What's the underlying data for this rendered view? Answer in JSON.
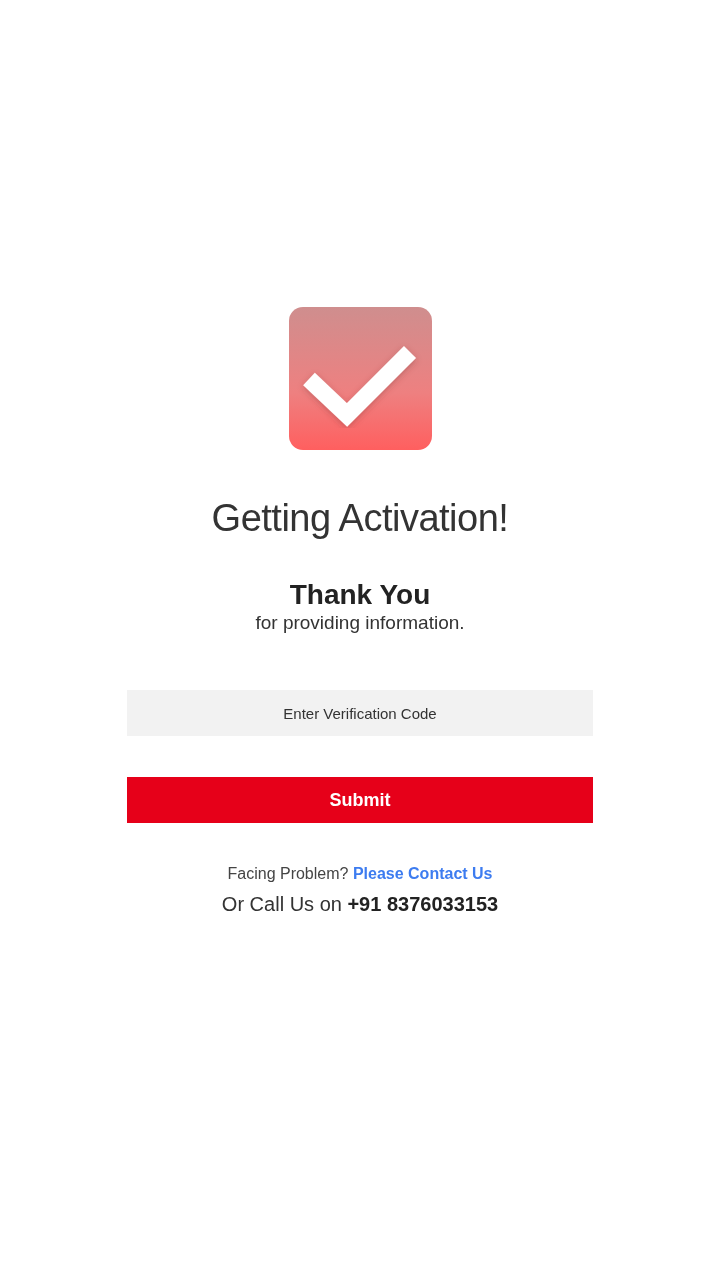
{
  "title": "Getting Activation!",
  "heading": "Thank You",
  "subheading": "for providing information.",
  "verification_field": {
    "placeholder": "Enter Verification Code"
  },
  "submit_button": "Submit",
  "help": {
    "text": "Facing Problem?",
    "link": "Please Contact Us"
  },
  "call_line": "Or Call Us on **+91 8376033153**"
}
